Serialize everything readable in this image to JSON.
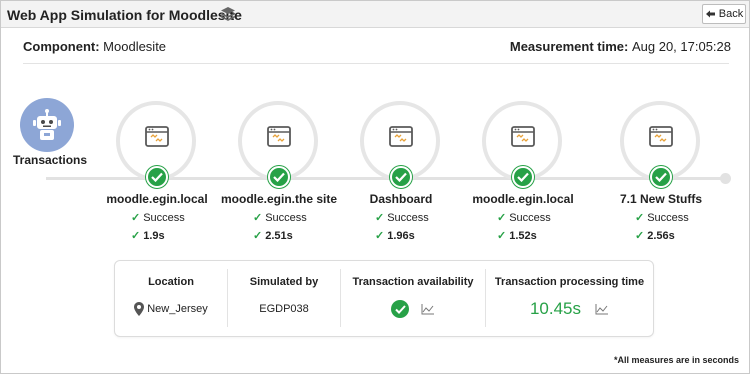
{
  "window": {
    "title": "Web App Simulation for Moodlesite",
    "title_icon": "layers-icon",
    "back_label": "Back"
  },
  "header": {
    "component_label": "Component:",
    "component_value": "Moodlesite",
    "measurement_label": "Measurement time:",
    "measurement_value": "Aug 20, 17:05:28"
  },
  "flow": {
    "start_label": "Transactions",
    "start_icon": "robot-icon",
    "steps": [
      {
        "name": "moodle.egin.local",
        "status": "Success",
        "time": "1.9s"
      },
      {
        "name": "moodle.egin.the site",
        "status": "Success",
        "time": "2.51s"
      },
      {
        "name": "Dashboard",
        "status": "Success",
        "time": "1.96s"
      },
      {
        "name": "moodle.egin.local",
        "status": "Success",
        "time": "1.52s"
      },
      {
        "name": "7.1 New Stuffs",
        "status": "Success",
        "time": "2.56s"
      }
    ]
  },
  "summary": {
    "location_head": "Location",
    "location_value": "New_Jersey",
    "simulated_head": "Simulated by",
    "simulated_value": "EGDP038",
    "availability_head": "Transaction availability",
    "processing_head": "Transaction processing time",
    "processing_value": "10.45s"
  },
  "footnote": "*All measures are in seconds",
  "colors": {
    "success": "#27a147",
    "robot_bg": "#8da6d6",
    "ring": "#e6e6e6",
    "timeline": "#e2e2e2"
  }
}
